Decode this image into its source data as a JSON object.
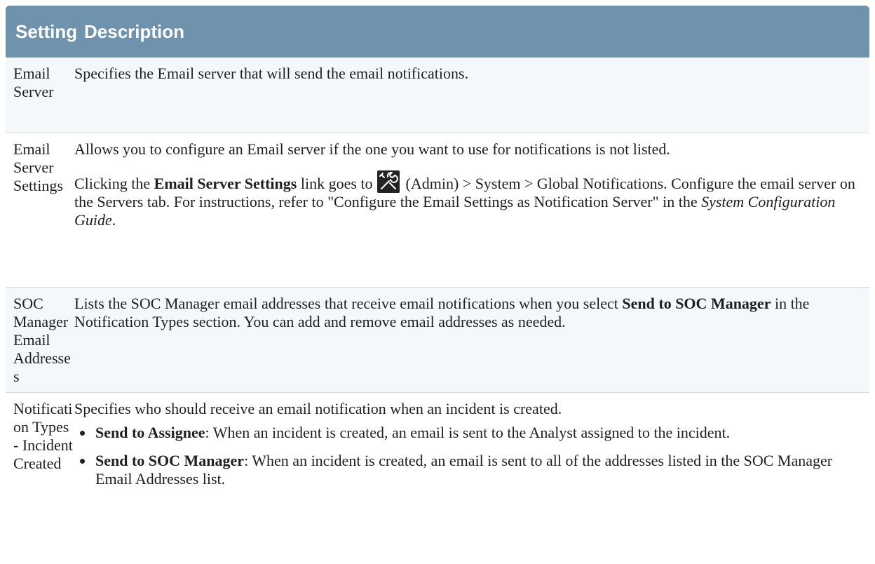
{
  "table": {
    "headers": {
      "setting": "Setting",
      "description": "Description"
    },
    "rows": [
      {
        "setting": "Email Server",
        "description": "Specifies the Email server that will send the email notifications."
      },
      {
        "setting": "Email Server Settings",
        "description_p1": "Allows you to configure an Email server if the one you want to use for notifications is not listed.",
        "p2_pre": "Clicking the ",
        "p2_bold": "Email Server Settings",
        "p2_mid1": " link goes to ",
        "admin_icon": "admin-tools-icon",
        "p2_mid2": " (Admin) > System > Global Notifications. Configure the email server on the Servers tab. For instructions, refer to \"Configure the Email Settings as Notification Server\" in the ",
        "p2_italic": "System Configuration Guide",
        "p2_post": "."
      },
      {
        "setting": "SOC Manager Email Addresses",
        "p_pre": "Lists the SOC Manager email addresses that receive email notifications when you select ",
        "p_bold": "Send to SOC Manager",
        "p_post": " in the Notification Types section. You can add and remove email addresses as needed."
      },
      {
        "setting": "Notification Types - Incident Created",
        "intro": "Specifies who should receive an email notification when an incident is created.",
        "bullets": [
          {
            "bold": "Send to Assignee",
            "text": ": When an incident is created, an email is sent to the Analyst assigned to the incident."
          },
          {
            "bold": "Send to SOC Manager",
            "text": ": When an incident is created, an email is sent to all of the addresses listed in the SOC Manager Email Addresses list."
          }
        ]
      }
    ]
  },
  "colors": {
    "header_bg": "#6f93ad",
    "header_text": "#ffffff",
    "alt_row_bg": "#f4f8fb",
    "divider": "#d9d9d9",
    "icon_bg": "#232323"
  }
}
